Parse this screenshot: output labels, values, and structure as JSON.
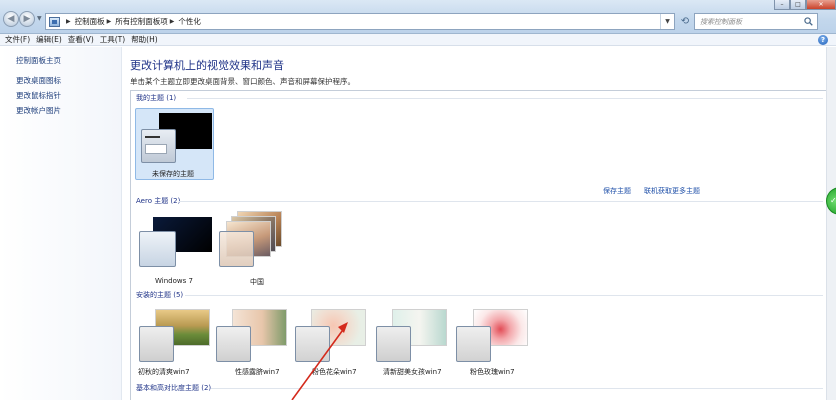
{
  "address_bar": {
    "breadcrumbs": [
      "控制面板",
      "所有控制面板项",
      "个性化"
    ]
  },
  "search": {
    "placeholder": "搜索控制面板"
  },
  "menu": [
    "文件(F)",
    "编辑(E)",
    "查看(V)",
    "工具(T)",
    "帮助(H)"
  ],
  "sidebar": {
    "items": [
      "控制面板主页",
      "更改桌面图标",
      "更改鼠标指针",
      "更改帐户图片"
    ]
  },
  "main": {
    "title": "更改计算机上的视觉效果和声音",
    "description": "单击某个主题立即更改桌面背景、窗口颜色、声音和屏幕保护程序。"
  },
  "sections": {
    "my_themes": {
      "header": "我的主题 (1)",
      "themes": [
        "未保存的主题"
      ],
      "links": {
        "save": "保存主题",
        "online": "联机获取更多主题"
      }
    },
    "aero_themes": {
      "header": "Aero 主题 (2)",
      "themes": [
        "Windows 7",
        "中国"
      ]
    },
    "installed_themes": {
      "header": "安装的主题 (5)",
      "themes": [
        "初秋的清爽win7",
        "性感露脐win7",
        "粉色花朵win7",
        "清新甜美女孩win7",
        "粉色玫瑰win7"
      ]
    },
    "basic_themes": {
      "header": "基本和高对比度主题 (2)"
    }
  },
  "colors": {
    "link": "#1e4fa8",
    "section_header": "#1e3287",
    "selected_bg": "#d5e6f8",
    "annotation_arrow": "#d42a1c"
  }
}
